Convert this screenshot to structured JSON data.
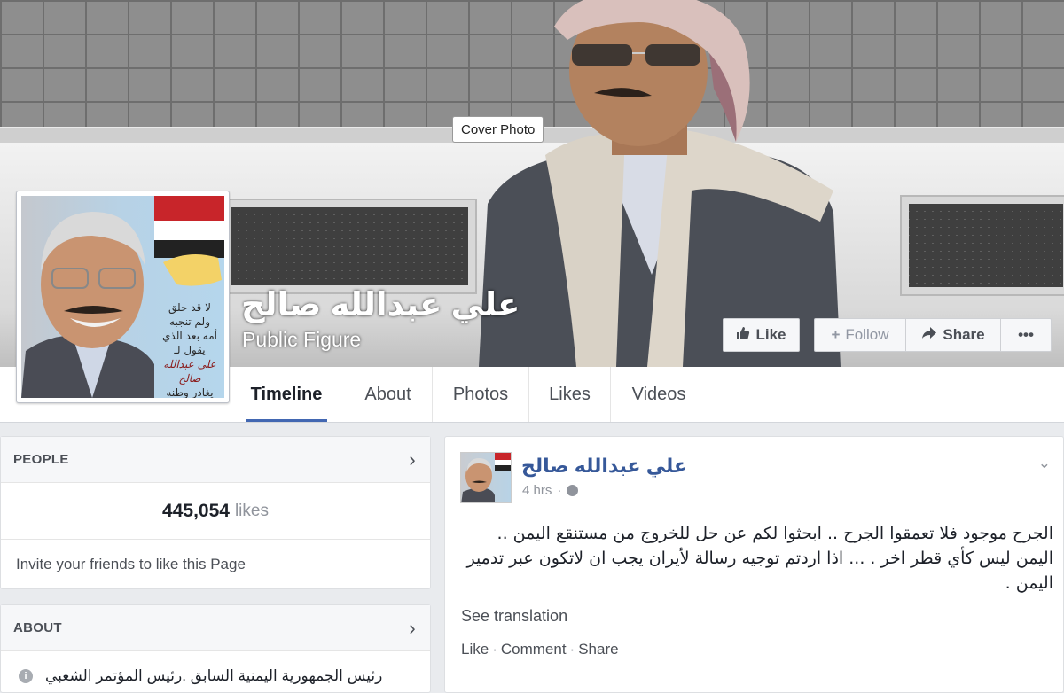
{
  "cover": {
    "tooltip": "Cover Photo"
  },
  "page": {
    "name": "علي عبدالله صالح",
    "category": "Public Figure"
  },
  "actions": {
    "like": "Like",
    "follow": "Follow",
    "share": "Share",
    "more": "•••"
  },
  "avatar": {
    "lines": [
      "لا قد خلق",
      "ولم تنجبه",
      "أمه بعد الذي",
      "يقول لـ",
      "علي عبدالله صالح",
      "يغادر وطنه"
    ]
  },
  "tabs": [
    {
      "label": "Timeline",
      "active": true
    },
    {
      "label": "About"
    },
    {
      "label": "Photos"
    },
    {
      "label": "Likes"
    },
    {
      "label": "Videos"
    }
  ],
  "people": {
    "heading": "PEOPLE",
    "likes_count": "445,054",
    "likes_word": "likes",
    "invite": "Invite your friends to like this Page"
  },
  "about": {
    "heading": "ABOUT",
    "text": "رئيس الجمهورية اليمنية السابق .رئيس المؤتمر الشعبي"
  },
  "post": {
    "author": "علي عبدالله صالح",
    "time": "4 hrs",
    "text": "الجرح موجود فلا تعمقوا الجرح .. ابحثوا لكم عن حل للخروج من مستنقع اليمن .. اليمن ليس كأي قطر اخر . ... اذا اردتم توجيه رسالة لأيران يجب ان لاتكون عبر تدمير اليمن .",
    "see_translation": "See translation",
    "actions": {
      "like": "Like",
      "comment": "Comment",
      "share": "Share",
      "sep": "·"
    }
  },
  "colors": {
    "link_blue": "#365899",
    "tab_underline": "#4267b2",
    "background": "#e9ebee"
  }
}
